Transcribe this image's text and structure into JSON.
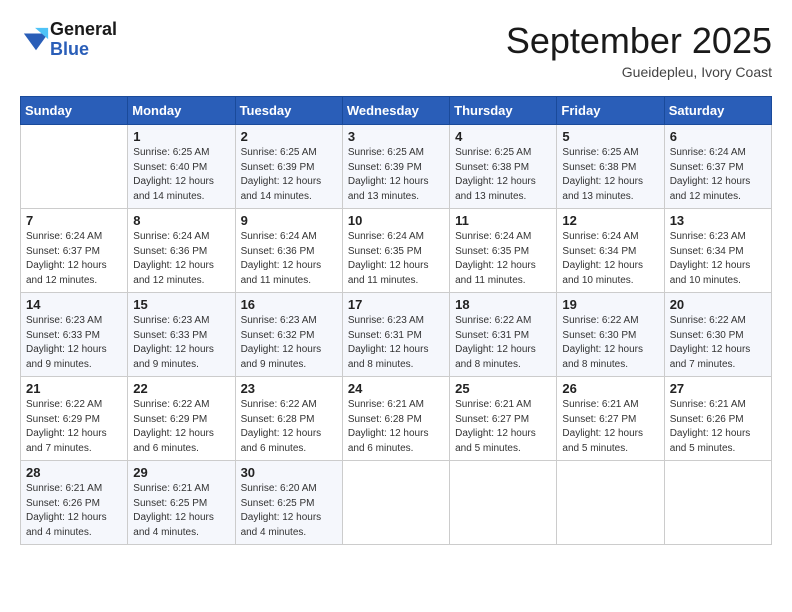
{
  "logo": {
    "line1": "General",
    "line2": "Blue"
  },
  "title": "September 2025",
  "subtitle": "Gueidepleu, Ivory Coast",
  "header_days": [
    "Sunday",
    "Monday",
    "Tuesday",
    "Wednesday",
    "Thursday",
    "Friday",
    "Saturday"
  ],
  "weeks": [
    [
      {
        "day": "",
        "info": ""
      },
      {
        "day": "1",
        "info": "Sunrise: 6:25 AM\nSunset: 6:40 PM\nDaylight: 12 hours\nand 14 minutes."
      },
      {
        "day": "2",
        "info": "Sunrise: 6:25 AM\nSunset: 6:39 PM\nDaylight: 12 hours\nand 14 minutes."
      },
      {
        "day": "3",
        "info": "Sunrise: 6:25 AM\nSunset: 6:39 PM\nDaylight: 12 hours\nand 13 minutes."
      },
      {
        "day": "4",
        "info": "Sunrise: 6:25 AM\nSunset: 6:38 PM\nDaylight: 12 hours\nand 13 minutes."
      },
      {
        "day": "5",
        "info": "Sunrise: 6:25 AM\nSunset: 6:38 PM\nDaylight: 12 hours\nand 13 minutes."
      },
      {
        "day": "6",
        "info": "Sunrise: 6:24 AM\nSunset: 6:37 PM\nDaylight: 12 hours\nand 12 minutes."
      }
    ],
    [
      {
        "day": "7",
        "info": "Sunrise: 6:24 AM\nSunset: 6:37 PM\nDaylight: 12 hours\nand 12 minutes."
      },
      {
        "day": "8",
        "info": "Sunrise: 6:24 AM\nSunset: 6:36 PM\nDaylight: 12 hours\nand 12 minutes."
      },
      {
        "day": "9",
        "info": "Sunrise: 6:24 AM\nSunset: 6:36 PM\nDaylight: 12 hours\nand 11 minutes."
      },
      {
        "day": "10",
        "info": "Sunrise: 6:24 AM\nSunset: 6:35 PM\nDaylight: 12 hours\nand 11 minutes."
      },
      {
        "day": "11",
        "info": "Sunrise: 6:24 AM\nSunset: 6:35 PM\nDaylight: 12 hours\nand 11 minutes."
      },
      {
        "day": "12",
        "info": "Sunrise: 6:24 AM\nSunset: 6:34 PM\nDaylight: 12 hours\nand 10 minutes."
      },
      {
        "day": "13",
        "info": "Sunrise: 6:23 AM\nSunset: 6:34 PM\nDaylight: 12 hours\nand 10 minutes."
      }
    ],
    [
      {
        "day": "14",
        "info": "Sunrise: 6:23 AM\nSunset: 6:33 PM\nDaylight: 12 hours\nand 9 minutes."
      },
      {
        "day": "15",
        "info": "Sunrise: 6:23 AM\nSunset: 6:33 PM\nDaylight: 12 hours\nand 9 minutes."
      },
      {
        "day": "16",
        "info": "Sunrise: 6:23 AM\nSunset: 6:32 PM\nDaylight: 12 hours\nand 9 minutes."
      },
      {
        "day": "17",
        "info": "Sunrise: 6:23 AM\nSunset: 6:31 PM\nDaylight: 12 hours\nand 8 minutes."
      },
      {
        "day": "18",
        "info": "Sunrise: 6:22 AM\nSunset: 6:31 PM\nDaylight: 12 hours\nand 8 minutes."
      },
      {
        "day": "19",
        "info": "Sunrise: 6:22 AM\nSunset: 6:30 PM\nDaylight: 12 hours\nand 8 minutes."
      },
      {
        "day": "20",
        "info": "Sunrise: 6:22 AM\nSunset: 6:30 PM\nDaylight: 12 hours\nand 7 minutes."
      }
    ],
    [
      {
        "day": "21",
        "info": "Sunrise: 6:22 AM\nSunset: 6:29 PM\nDaylight: 12 hours\nand 7 minutes."
      },
      {
        "day": "22",
        "info": "Sunrise: 6:22 AM\nSunset: 6:29 PM\nDaylight: 12 hours\nand 6 minutes."
      },
      {
        "day": "23",
        "info": "Sunrise: 6:22 AM\nSunset: 6:28 PM\nDaylight: 12 hours\nand 6 minutes."
      },
      {
        "day": "24",
        "info": "Sunrise: 6:21 AM\nSunset: 6:28 PM\nDaylight: 12 hours\nand 6 minutes."
      },
      {
        "day": "25",
        "info": "Sunrise: 6:21 AM\nSunset: 6:27 PM\nDaylight: 12 hours\nand 5 minutes."
      },
      {
        "day": "26",
        "info": "Sunrise: 6:21 AM\nSunset: 6:27 PM\nDaylight: 12 hours\nand 5 minutes."
      },
      {
        "day": "27",
        "info": "Sunrise: 6:21 AM\nSunset: 6:26 PM\nDaylight: 12 hours\nand 5 minutes."
      }
    ],
    [
      {
        "day": "28",
        "info": "Sunrise: 6:21 AM\nSunset: 6:26 PM\nDaylight: 12 hours\nand 4 minutes."
      },
      {
        "day": "29",
        "info": "Sunrise: 6:21 AM\nSunset: 6:25 PM\nDaylight: 12 hours\nand 4 minutes."
      },
      {
        "day": "30",
        "info": "Sunrise: 6:20 AM\nSunset: 6:25 PM\nDaylight: 12 hours\nand 4 minutes."
      },
      {
        "day": "",
        "info": ""
      },
      {
        "day": "",
        "info": ""
      },
      {
        "day": "",
        "info": ""
      },
      {
        "day": "",
        "info": ""
      }
    ]
  ]
}
